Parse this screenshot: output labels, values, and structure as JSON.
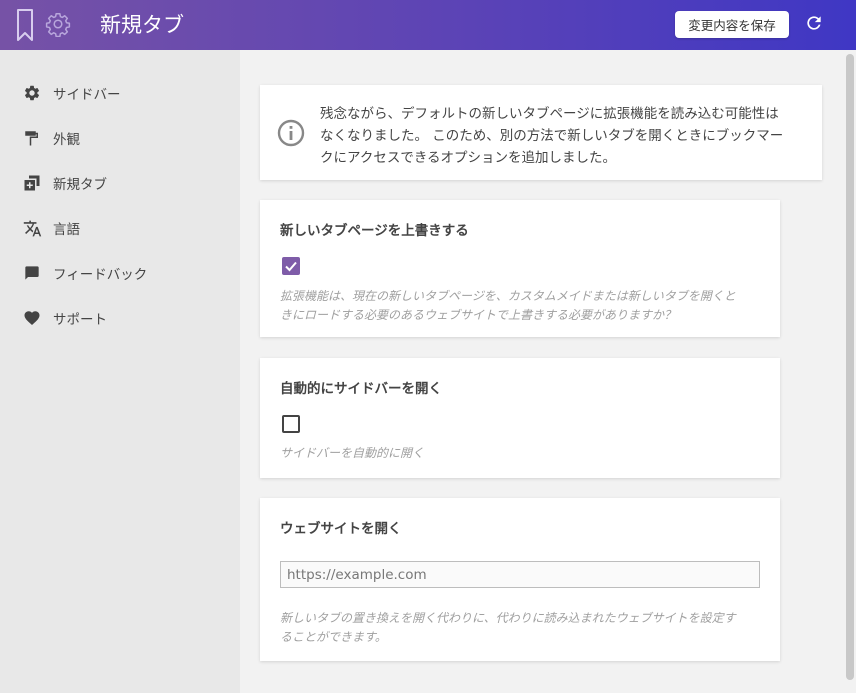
{
  "header": {
    "title": "新規タブ",
    "save_label": "変更内容を保存",
    "gradient_start": "#7652a6",
    "gradient_end": "#3f37c4"
  },
  "sidebar": {
    "items": [
      {
        "label": "サイドバー",
        "icon": "gear-icon"
      },
      {
        "label": "外観",
        "icon": "paint-roller-icon"
      },
      {
        "label": "新規タブ",
        "icon": "new-tab-icon"
      },
      {
        "label": "言語",
        "icon": "translate-icon"
      },
      {
        "label": "フィードバック",
        "icon": "chat-icon"
      },
      {
        "label": "サポート",
        "icon": "heart-icon"
      }
    ]
  },
  "notice": {
    "line1": "残念ながら、デフォルトの新しいタブページに拡張機能を読み込む可能性は",
    "line2": "なくなりました。 このため、別の方法で新しいタブを開くときにブックマー",
    "line3": "クにアクセスできるオプションを追加しました。",
    "icon": "info-icon"
  },
  "sections": {
    "override": {
      "title": "新しいタブページを上書きする",
      "checked": true,
      "helper_line1": "拡張機能は、現在の新しいタブページを、カスタムメイドまたは新しいタブを開くと",
      "helper_line2": "きにロードする必要のあるウェブサイトで上書きする必要がありますか？"
    },
    "sidebar_open": {
      "title": "自動的にサイドバーを開く",
      "checked": false,
      "helper": "サイドバーを自動的に開く"
    },
    "website": {
      "title": "ウェブサイトを開く",
      "placeholder": "https://example.com",
      "helper_line1": "新しいタブの置き換えを開く代わりに、代わりに読み込まれたウェブサイトを設定す",
      "helper_line2": "ることができます。"
    }
  },
  "colors": {
    "accent": "#7e5ca8",
    "sidebar_bg": "#e8e8e8",
    "main_bg": "#f2f2f2"
  }
}
